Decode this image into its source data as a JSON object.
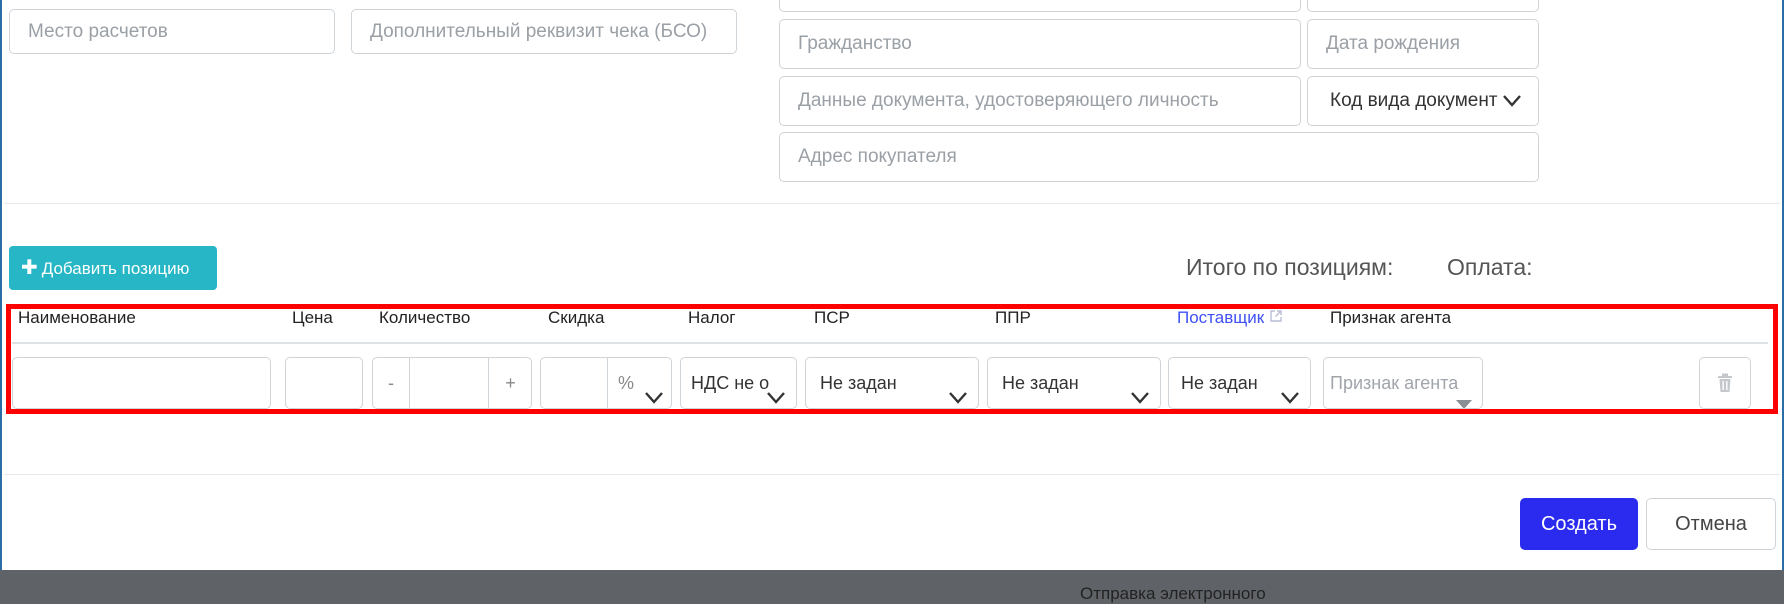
{
  "form": {
    "place_of_settlement": "Место расчетов",
    "additional_requisite": "Дополнительный реквизит чека (БСО)",
    "citizenship": "Гражданство",
    "birth_date": "Дата рождения",
    "id_document_data": "Данные документа, удостоверяющего личность",
    "doc_type_code": "Код вида документ",
    "buyer_address": "Адрес покупателя"
  },
  "positions": {
    "add_button_label": "Добавить позицию",
    "total_label": "Итого по позициям:",
    "payment_label": "Оплата:",
    "columns": [
      "Наименование",
      "Цена",
      "Количество",
      "Скидка",
      "Налог",
      "ПСР",
      "ППР",
      "Поставщик",
      "Признак агента"
    ],
    "row": {
      "qty_minus": "-",
      "qty_plus": "+",
      "discount_unit": "%",
      "tax": "НДС не о",
      "psr": "Не задан",
      "ppr": "Не задан",
      "supplier": "Не задан",
      "agent_placeholder": "Признак агента"
    }
  },
  "actions": {
    "create": "Создать",
    "cancel": "Отмена"
  },
  "background_peek": "Отправка электронного",
  "colors": {
    "add_button": "#26b6c6",
    "create_button": "#2b2bef",
    "highlight_border": "#ff0000",
    "link": "#3f51f5"
  }
}
